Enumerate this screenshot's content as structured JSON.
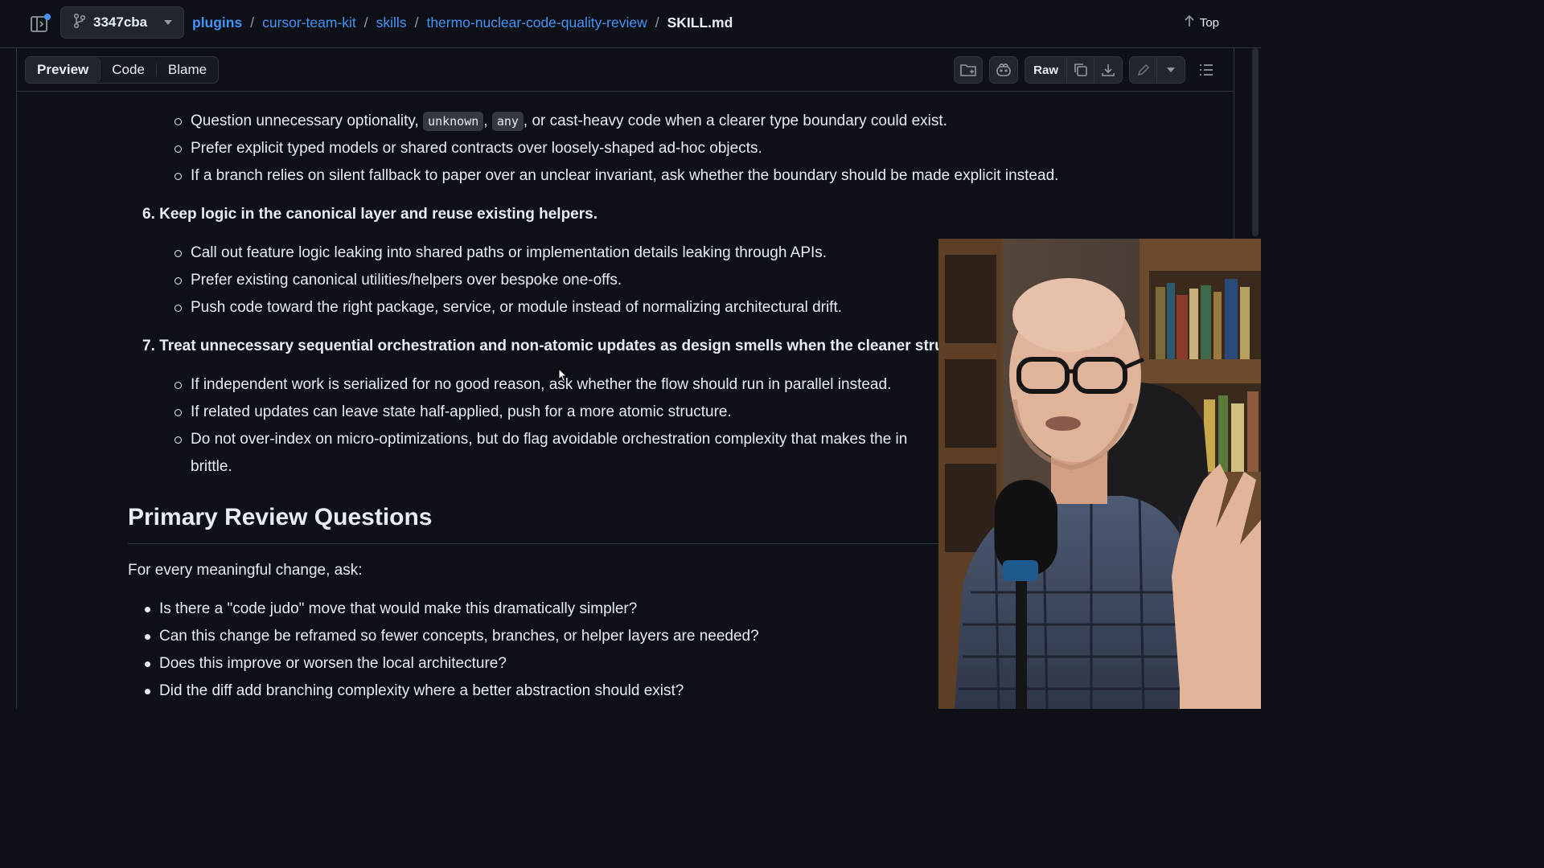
{
  "topbar": {
    "branch": "3347cba",
    "breadcrumbs": [
      "plugins",
      "cursor-team-kit",
      "skills",
      "thermo-nuclear-code-quality-review"
    ],
    "separator": "/",
    "current_file": "SKILL.md",
    "top_label": "Top"
  },
  "filebar": {
    "tabs": {
      "preview": "Preview",
      "code": "Code",
      "blame": "Blame"
    },
    "raw_label": "Raw"
  },
  "content": {
    "group5_bullets": {
      "b1_pre": "Question unnecessary optionality,",
      "b1_code1": "unknown",
      "b1_sep": ",",
      "b1_code2": "any",
      "b1_post": ", or cast-heavy code when a clearer type boundary could exist.",
      "b2": "Prefer explicit typed models or shared contracts over loosely-shaped ad-hoc objects.",
      "b3": "If a branch relies on silent fallback to paper over an unclear invariant, ask whether the boundary should be made explicit instead."
    },
    "item6": {
      "num": "6.",
      "text": "Keep logic in the canonical layer and reuse existing helpers."
    },
    "group6_bullets": [
      "Call out feature logic leaking into shared paths or implementation details leaking through APIs.",
      "Prefer existing canonical utilities/helpers over bespoke one-offs.",
      "Push code toward the right package, service, or module instead of normalizing architectural drift."
    ],
    "item7": {
      "num": "7.",
      "text": "Treat unnecessary sequential orchestration and non-atomic updates as design smells when the cleaner structu"
    },
    "group7_bullets": [
      "If independent work is serialized for no good reason, ask whether the flow should run in parallel instead.",
      "If related updates can leave state half-applied, push for a more atomic structure.",
      "Do not over-index on micro-optimizations, but do flag avoidable orchestration complexity that makes the in brittle."
    ],
    "heading": "Primary Review Questions",
    "intro": "For every meaningful change, ask:",
    "questions": [
      "Is there a \"code judo\" move that would make this dramatically simpler?",
      "Can this change be reframed so fewer concepts, branches, or helper layers are needed?",
      "Does this improve or worsen the local architecture?",
      "Did the diff add branching complexity where a better abstraction should exist?"
    ]
  },
  "colors": {
    "background": "#0d1117",
    "link": "#4493f8",
    "border": "#30363d",
    "text": "#e6edf3"
  },
  "icons": [
    "sidebar-toggle-icon",
    "git-branch-icon",
    "arrow-up-icon",
    "folder-icon",
    "copilot-icon",
    "copy-icon",
    "download-icon",
    "pencil-icon",
    "list-icon"
  ]
}
